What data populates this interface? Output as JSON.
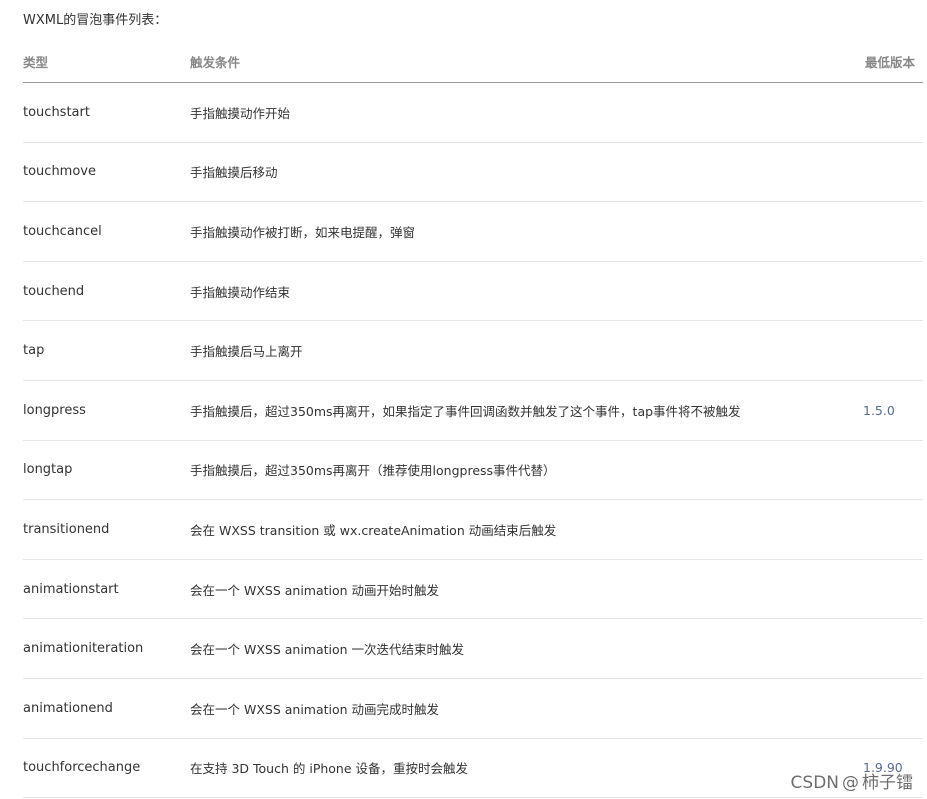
{
  "intro": "WXML的冒泡事件列表：",
  "table": {
    "headers": [
      "类型",
      "触发条件",
      "最低版本"
    ],
    "rows": [
      {
        "type": "touchstart",
        "condition": "手指触摸动作开始",
        "version": ""
      },
      {
        "type": "touchmove",
        "condition": "手指触摸后移动",
        "version": ""
      },
      {
        "type": "touchcancel",
        "condition": "手指触摸动作被打断，如来电提醒，弹窗",
        "version": ""
      },
      {
        "type": "touchend",
        "condition": "手指触摸动作结束",
        "version": ""
      },
      {
        "type": "tap",
        "condition": "手指触摸后马上离开",
        "version": ""
      },
      {
        "type": "longpress",
        "condition": "手指触摸后，超过350ms再离开，如果指定了事件回调函数并触发了这个事件，tap事件将不被触发",
        "version": "1.5.0"
      },
      {
        "type": "longtap",
        "condition": "手指触摸后，超过350ms再离开（推荐使用longpress事件代替）",
        "version": ""
      },
      {
        "type": "transitionend",
        "condition": "会在 WXSS transition 或 wx.createAnimation 动画结束后触发",
        "version": ""
      },
      {
        "type": "animationstart",
        "condition": "会在一个 WXSS animation 动画开始时触发",
        "version": ""
      },
      {
        "type": "animationiteration",
        "condition": "会在一个 WXSS animation 一次迭代结束时触发",
        "version": ""
      },
      {
        "type": "animationend",
        "condition": "会在一个 WXSS animation 动画完成时触发",
        "version": ""
      },
      {
        "type": "touchforcechange",
        "condition": "在支持 3D Touch 的 iPhone 设备，重按时会触发",
        "version": "1.9.90"
      }
    ]
  },
  "watermark": {
    "brand": "CSDN",
    "separator": "@",
    "author": "柿子镭"
  },
  "colors": {
    "text": "#333333",
    "header_text": "#888888",
    "version_link": "#576b95",
    "row_border": "#e6e6e6",
    "header_border": "#9a9a9a"
  }
}
